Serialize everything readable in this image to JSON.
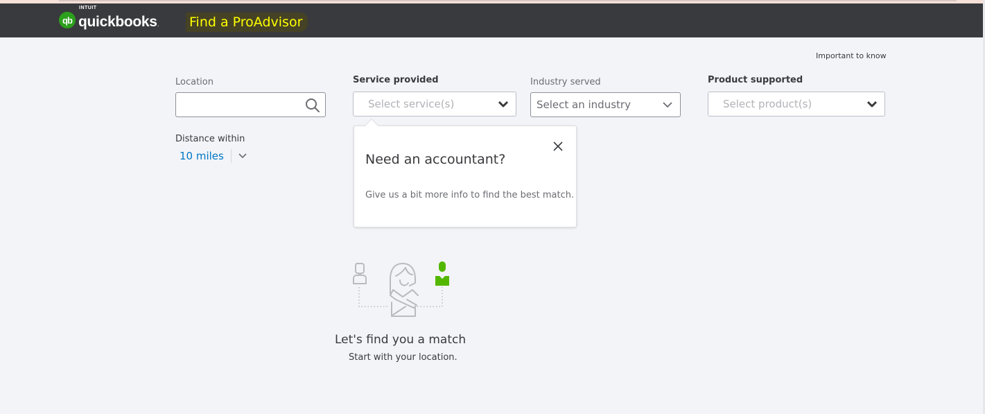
{
  "header": {
    "logo": {
      "badge": "qb",
      "brand_small": "INTUIT",
      "brand_word": "quickbooks",
      "brand_dot": "."
    },
    "title": "Find a ProAdvisor"
  },
  "links": {
    "important": "Important to know"
  },
  "filters": {
    "location": {
      "label": "Location",
      "value": "",
      "placeholder": ""
    },
    "service": {
      "label": "Service provided",
      "placeholder": "Select service(s)"
    },
    "industry": {
      "label": "Industry served",
      "placeholder": "Select an industry"
    },
    "product": {
      "label": "Product supported",
      "placeholder": "Select product(s)"
    },
    "distance": {
      "label": "Distance within",
      "value": "10 miles"
    }
  },
  "popover": {
    "title": "Need an accountant?",
    "body": "Give us a bit more info to find the best match."
  },
  "empty_state": {
    "title": "Let's find you a match",
    "subtitle": "Start with your location."
  },
  "colors": {
    "header_bg": "#393a3d",
    "brand_green": "#2ca01c",
    "link_blue": "#0077c5",
    "highlight": "#ffff00",
    "page_bg": "#f3f4f8"
  }
}
